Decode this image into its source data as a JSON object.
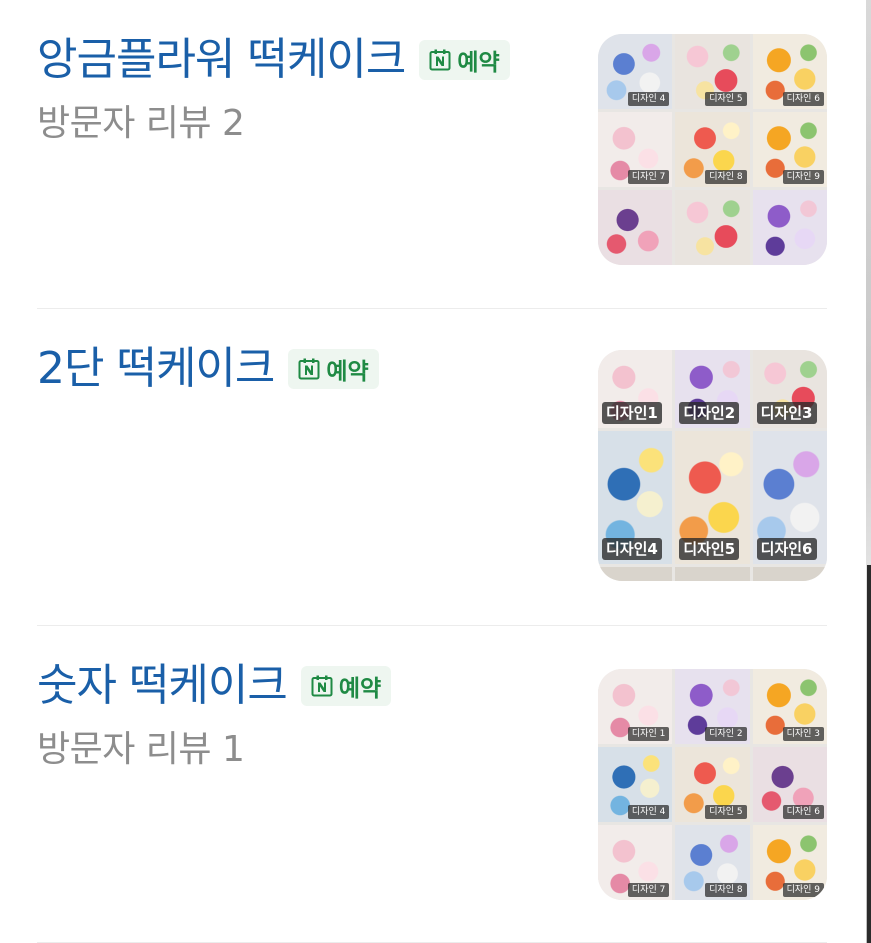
{
  "items": [
    {
      "title": "앙금플라워 떡케이크",
      "badge": "예약",
      "review": "방문자 리뷰 2",
      "thumb_tags": [
        "디자인 4",
        "디자인 5",
        "디자인 6",
        "디자인 7",
        "디자인 8",
        "디자인 9"
      ]
    },
    {
      "title": "2단 떡케이크",
      "badge": "예약",
      "review": "",
      "thumb_tags": [
        "디자인1",
        "디자인2",
        "디자인3",
        "디자인4",
        "디자인5",
        "디자인6"
      ]
    },
    {
      "title": "숫자 떡케이크",
      "badge": "예약",
      "review": "방문자 리뷰 1",
      "thumb_tags": [
        "디자인 1",
        "디자인 2",
        "디자인 3",
        "디자인 4",
        "디자인 5",
        "디자인 6",
        "디자인 7",
        "디자인 8",
        "디자인 9"
      ]
    }
  ],
  "badge_icon": "naver-booking-calendar-icon",
  "colors": {
    "title": "#1a5fa8",
    "badge_bg": "#eef6f0",
    "badge_text": "#1f8a44",
    "review": "#8d8d8d",
    "divider": "#ececec"
  }
}
